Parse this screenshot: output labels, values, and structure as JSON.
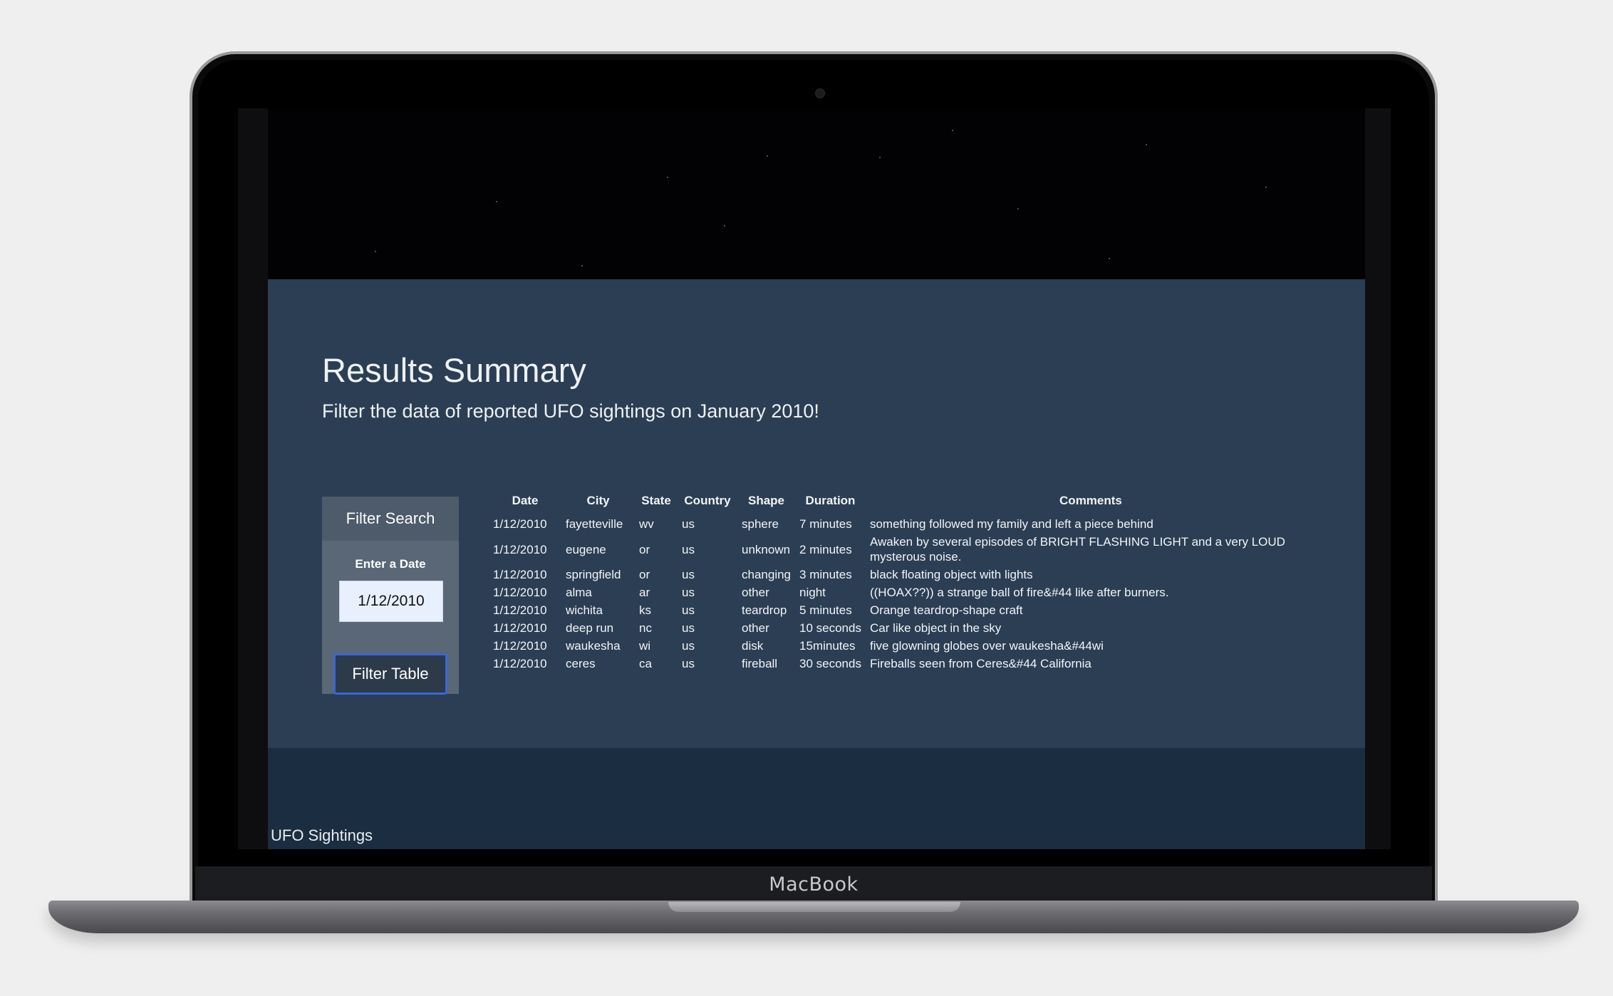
{
  "device": {
    "brand_label": "MacBook"
  },
  "page": {
    "title": "Results Summary",
    "subtitle": "Filter the data of reported UFO sightings on January 2010!",
    "footer_text": "UFO Sightings"
  },
  "filter": {
    "heading": "Filter Search",
    "date_label": "Enter a Date",
    "date_value": "1/12/2010",
    "button_label": "Filter Table"
  },
  "table": {
    "columns": [
      "Date",
      "City",
      "State",
      "Country",
      "Shape",
      "Duration",
      "Comments"
    ],
    "rows": [
      {
        "date": "1/12/2010",
        "city": "fayetteville",
        "state": "wv",
        "country": "us",
        "shape": "sphere",
        "duration": "7 minutes",
        "comments": "something followed my family and left a piece behind"
      },
      {
        "date": "1/12/2010",
        "city": "eugene",
        "state": "or",
        "country": "us",
        "shape": "unknown",
        "duration": "2 minutes",
        "comments": "Awaken by several episodes of BRIGHT FLASHING LIGHT and a very LOUD mysterous noise."
      },
      {
        "date": "1/12/2010",
        "city": "springfield",
        "state": "or",
        "country": "us",
        "shape": "changing",
        "duration": "3 minutes",
        "comments": "black floating object with lights"
      },
      {
        "date": "1/12/2010",
        "city": "alma",
        "state": "ar",
        "country": "us",
        "shape": "other",
        "duration": "night",
        "comments": "((HOAX??)) a strange ball of fire&#44 like after burners."
      },
      {
        "date": "1/12/2010",
        "city": "wichita",
        "state": "ks",
        "country": "us",
        "shape": "teardrop",
        "duration": "5 minutes",
        "comments": "Orange teardrop-shape craft"
      },
      {
        "date": "1/12/2010",
        "city": "deep run",
        "state": "nc",
        "country": "us",
        "shape": "other",
        "duration": "10 seconds",
        "comments": "Car like object in the sky"
      },
      {
        "date": "1/12/2010",
        "city": "waukesha",
        "state": "wi",
        "country": "us",
        "shape": "disk",
        "duration": "15minutes",
        "comments": "five glowning globes over waukesha&#44wi"
      },
      {
        "date": "1/12/2010",
        "city": "ceres",
        "state": "ca",
        "country": "us",
        "shape": "fireball",
        "duration": "30 seconds",
        "comments": "Fireballs seen from Ceres&#44 California"
      }
    ]
  },
  "colors": {
    "main_background": "#2b3e54",
    "footer_background": "#1b2d40",
    "button_border": "#3a66d6"
  }
}
